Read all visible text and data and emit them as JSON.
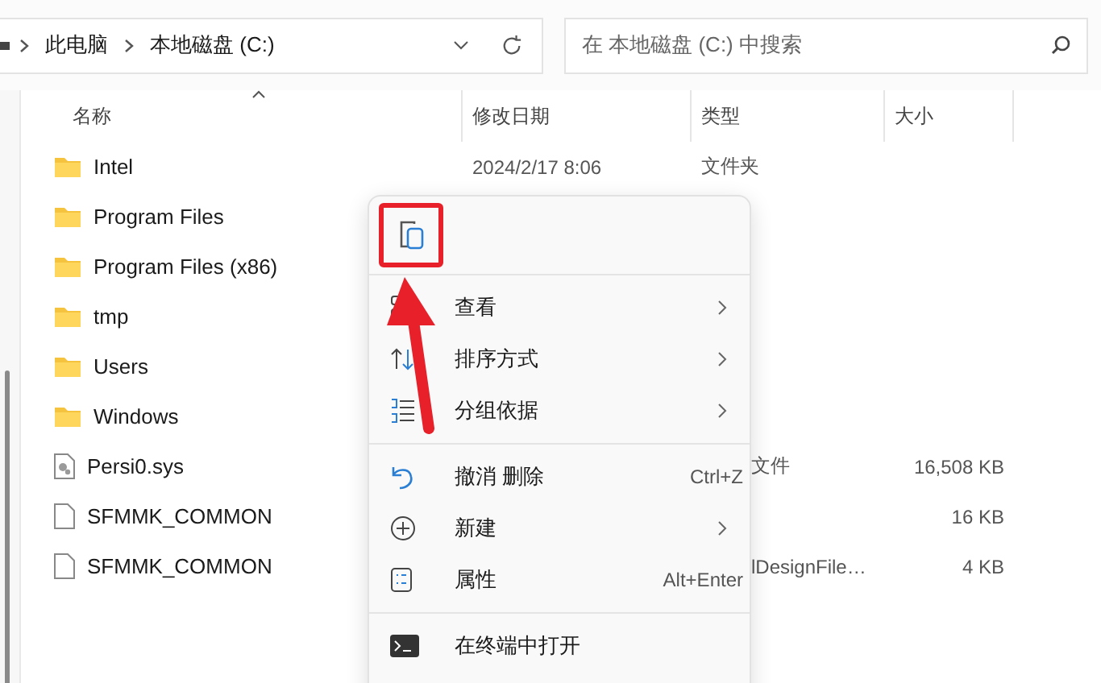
{
  "address_bar": {
    "path": [
      "此电脑",
      "本地磁盘 (C:)"
    ]
  },
  "search": {
    "placeholder": "在 本地磁盘 (C:) 中搜索"
  },
  "columns": [
    {
      "label": "名称",
      "sorted": true
    },
    {
      "label": "修改日期",
      "sorted": false
    },
    {
      "label": "类型",
      "sorted": false
    },
    {
      "label": "大小",
      "sorted": false
    }
  ],
  "files": [
    {
      "name": "Intel",
      "kind": "folder",
      "date": "2024/2/17 8:06",
      "type": "文件夹"
    },
    {
      "name": "Program Files",
      "kind": "folder"
    },
    {
      "name": "Program Files (x86)",
      "kind": "folder"
    },
    {
      "name": "tmp",
      "kind": "folder"
    },
    {
      "name": "Users",
      "kind": "folder"
    },
    {
      "name": "Windows",
      "kind": "folder"
    },
    {
      "name": "Persi0.sys",
      "kind": "system",
      "type": "文件",
      "size": "16,508 KB"
    },
    {
      "name": "SFMMK_COMMON",
      "kind": "file",
      "size": "16 KB"
    },
    {
      "name": "SFMMK_COMMON",
      "kind": "file",
      "type": "lDesignFile…",
      "size": "4 KB"
    }
  ],
  "context_menu": {
    "quick_actions": [
      {
        "kind": "paste",
        "highlighted": true
      }
    ],
    "sections": [
      [
        {
          "label": "查看",
          "kind": "submenu"
        },
        {
          "label": "排序方式",
          "kind": "submenu"
        },
        {
          "label": "分组依据",
          "kind": "submenu"
        }
      ],
      [
        {
          "label": "撤消 删除",
          "kind": "command",
          "shortcut": "Ctrl+Z"
        },
        {
          "label": "新建",
          "kind": "submenu"
        },
        {
          "label": "属性",
          "kind": "command",
          "shortcut": "Alt+Enter"
        }
      ],
      [
        {
          "label": "在终端中打开",
          "kind": "command"
        }
      ]
    ]
  }
}
